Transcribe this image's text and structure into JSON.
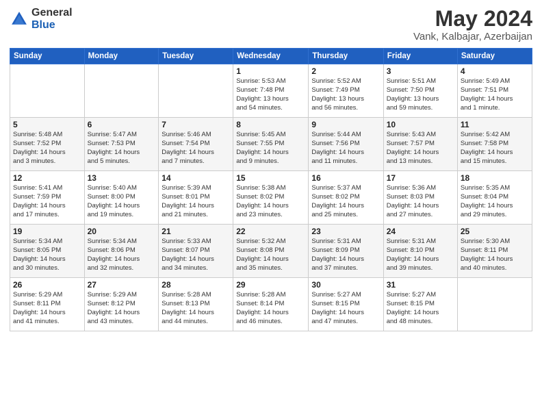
{
  "header": {
    "logo_general": "General",
    "logo_blue": "Blue",
    "title": "May 2024",
    "subtitle": "Vank, Kalbajar, Azerbaijan"
  },
  "days_of_week": [
    "Sunday",
    "Monday",
    "Tuesday",
    "Wednesday",
    "Thursday",
    "Friday",
    "Saturday"
  ],
  "weeks": [
    [
      {
        "day": "",
        "info": ""
      },
      {
        "day": "",
        "info": ""
      },
      {
        "day": "",
        "info": ""
      },
      {
        "day": "1",
        "info": "Sunrise: 5:53 AM\nSunset: 7:48 PM\nDaylight: 13 hours\nand 54 minutes."
      },
      {
        "day": "2",
        "info": "Sunrise: 5:52 AM\nSunset: 7:49 PM\nDaylight: 13 hours\nand 56 minutes."
      },
      {
        "day": "3",
        "info": "Sunrise: 5:51 AM\nSunset: 7:50 PM\nDaylight: 13 hours\nand 59 minutes."
      },
      {
        "day": "4",
        "info": "Sunrise: 5:49 AM\nSunset: 7:51 PM\nDaylight: 14 hours\nand 1 minute."
      }
    ],
    [
      {
        "day": "5",
        "info": "Sunrise: 5:48 AM\nSunset: 7:52 PM\nDaylight: 14 hours\nand 3 minutes."
      },
      {
        "day": "6",
        "info": "Sunrise: 5:47 AM\nSunset: 7:53 PM\nDaylight: 14 hours\nand 5 minutes."
      },
      {
        "day": "7",
        "info": "Sunrise: 5:46 AM\nSunset: 7:54 PM\nDaylight: 14 hours\nand 7 minutes."
      },
      {
        "day": "8",
        "info": "Sunrise: 5:45 AM\nSunset: 7:55 PM\nDaylight: 14 hours\nand 9 minutes."
      },
      {
        "day": "9",
        "info": "Sunrise: 5:44 AM\nSunset: 7:56 PM\nDaylight: 14 hours\nand 11 minutes."
      },
      {
        "day": "10",
        "info": "Sunrise: 5:43 AM\nSunset: 7:57 PM\nDaylight: 14 hours\nand 13 minutes."
      },
      {
        "day": "11",
        "info": "Sunrise: 5:42 AM\nSunset: 7:58 PM\nDaylight: 14 hours\nand 15 minutes."
      }
    ],
    [
      {
        "day": "12",
        "info": "Sunrise: 5:41 AM\nSunset: 7:59 PM\nDaylight: 14 hours\nand 17 minutes."
      },
      {
        "day": "13",
        "info": "Sunrise: 5:40 AM\nSunset: 8:00 PM\nDaylight: 14 hours\nand 19 minutes."
      },
      {
        "day": "14",
        "info": "Sunrise: 5:39 AM\nSunset: 8:01 PM\nDaylight: 14 hours\nand 21 minutes."
      },
      {
        "day": "15",
        "info": "Sunrise: 5:38 AM\nSunset: 8:02 PM\nDaylight: 14 hours\nand 23 minutes."
      },
      {
        "day": "16",
        "info": "Sunrise: 5:37 AM\nSunset: 8:02 PM\nDaylight: 14 hours\nand 25 minutes."
      },
      {
        "day": "17",
        "info": "Sunrise: 5:36 AM\nSunset: 8:03 PM\nDaylight: 14 hours\nand 27 minutes."
      },
      {
        "day": "18",
        "info": "Sunrise: 5:35 AM\nSunset: 8:04 PM\nDaylight: 14 hours\nand 29 minutes."
      }
    ],
    [
      {
        "day": "19",
        "info": "Sunrise: 5:34 AM\nSunset: 8:05 PM\nDaylight: 14 hours\nand 30 minutes."
      },
      {
        "day": "20",
        "info": "Sunrise: 5:34 AM\nSunset: 8:06 PM\nDaylight: 14 hours\nand 32 minutes."
      },
      {
        "day": "21",
        "info": "Sunrise: 5:33 AM\nSunset: 8:07 PM\nDaylight: 14 hours\nand 34 minutes."
      },
      {
        "day": "22",
        "info": "Sunrise: 5:32 AM\nSunset: 8:08 PM\nDaylight: 14 hours\nand 35 minutes."
      },
      {
        "day": "23",
        "info": "Sunrise: 5:31 AM\nSunset: 8:09 PM\nDaylight: 14 hours\nand 37 minutes."
      },
      {
        "day": "24",
        "info": "Sunrise: 5:31 AM\nSunset: 8:10 PM\nDaylight: 14 hours\nand 39 minutes."
      },
      {
        "day": "25",
        "info": "Sunrise: 5:30 AM\nSunset: 8:11 PM\nDaylight: 14 hours\nand 40 minutes."
      }
    ],
    [
      {
        "day": "26",
        "info": "Sunrise: 5:29 AM\nSunset: 8:11 PM\nDaylight: 14 hours\nand 41 minutes."
      },
      {
        "day": "27",
        "info": "Sunrise: 5:29 AM\nSunset: 8:12 PM\nDaylight: 14 hours\nand 43 minutes."
      },
      {
        "day": "28",
        "info": "Sunrise: 5:28 AM\nSunset: 8:13 PM\nDaylight: 14 hours\nand 44 minutes."
      },
      {
        "day": "29",
        "info": "Sunrise: 5:28 AM\nSunset: 8:14 PM\nDaylight: 14 hours\nand 46 minutes."
      },
      {
        "day": "30",
        "info": "Sunrise: 5:27 AM\nSunset: 8:15 PM\nDaylight: 14 hours\nand 47 minutes."
      },
      {
        "day": "31",
        "info": "Sunrise: 5:27 AM\nSunset: 8:15 PM\nDaylight: 14 hours\nand 48 minutes."
      },
      {
        "day": "",
        "info": ""
      }
    ]
  ]
}
